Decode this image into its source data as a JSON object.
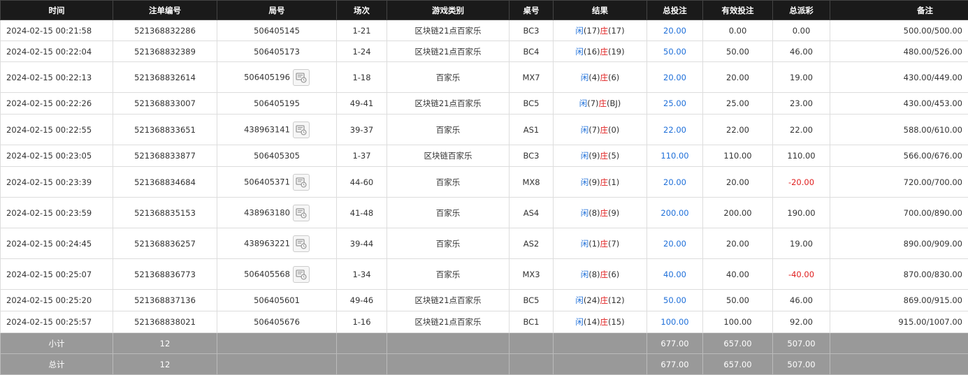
{
  "headers": [
    "时间",
    "注单编号",
    "局号",
    "场次",
    "游戏类别",
    "桌号",
    "结果",
    "总投注",
    "有效投注",
    "总派彩",
    "备注"
  ],
  "rows": [
    {
      "time": "2024-02-15 00:21:58",
      "order": "521368832286",
      "round": "506405145",
      "icon": false,
      "session": "1-21",
      "game": "区块链21点百家乐",
      "table": "BC3",
      "xian": "闲",
      "xv": "(17)",
      "zhuang": "庄",
      "zv": "(17)",
      "bet": "20.00",
      "valid": "0.00",
      "payout": "0.00",
      "neg": false,
      "remark": "500.00/500.00",
      "h": 30
    },
    {
      "time": "2024-02-15 00:22:04",
      "order": "521368832389",
      "round": "506405173",
      "icon": false,
      "session": "1-24",
      "game": "区块链21点百家乐",
      "table": "BC4",
      "xian": "闲",
      "xv": "(16)",
      "zhuang": "庄",
      "zv": "(19)",
      "bet": "50.00",
      "valid": "50.00",
      "payout": "46.00",
      "neg": false,
      "remark": "480.00/526.00",
      "h": 30
    },
    {
      "time": "2024-02-15 00:22:13",
      "order": "521368832614",
      "round": "506405196",
      "icon": true,
      "session": "1-18",
      "game": "百家乐",
      "table": "MX7",
      "xian": "闲",
      "xv": "(4)",
      "zhuang": "庄",
      "zv": "(6)",
      "bet": "20.00",
      "valid": "20.00",
      "payout": "19.00",
      "neg": false,
      "remark": "430.00/449.00",
      "h": 44
    },
    {
      "time": "2024-02-15 00:22:26",
      "order": "521368833007",
      "round": "506405195",
      "icon": false,
      "session": "49-41",
      "game": "区块链21点百家乐",
      "table": "BC5",
      "xian": "闲",
      "xv": "(7)",
      "zhuang": "庄",
      "zv": "(BJ)",
      "bet": "25.00",
      "valid": "25.00",
      "payout": "23.00",
      "neg": false,
      "remark": "430.00/453.00",
      "h": 31
    },
    {
      "time": "2024-02-15 00:22:55",
      "order": "521368833651",
      "round": "438963141",
      "icon": true,
      "session": "39-37",
      "game": "百家乐",
      "table": "AS1",
      "xian": "闲",
      "xv": "(7)",
      "zhuang": "庄",
      "zv": "(0)",
      "bet": "22.00",
      "valid": "22.00",
      "payout": "22.00",
      "neg": false,
      "remark": "588.00/610.00",
      "h": 44
    },
    {
      "time": "2024-02-15 00:23:05",
      "order": "521368833877",
      "round": "506405305",
      "icon": false,
      "session": "1-37",
      "game": "区块链百家乐",
      "table": "BC3",
      "xian": "闲",
      "xv": "(9)",
      "zhuang": "庄",
      "zv": "(5)",
      "bet": "110.00",
      "valid": "110.00",
      "payout": "110.00",
      "neg": false,
      "remark": "566.00/676.00",
      "h": 31
    },
    {
      "time": "2024-02-15 00:23:39",
      "order": "521368834684",
      "round": "506405371",
      "icon": true,
      "session": "44-60",
      "game": "百家乐",
      "table": "MX8",
      "xian": "闲",
      "xv": "(9)",
      "zhuang": "庄",
      "zv": "(1)",
      "bet": "20.00",
      "valid": "20.00",
      "payout": "-20.00",
      "neg": true,
      "remark": "720.00/700.00",
      "h": 44
    },
    {
      "time": "2024-02-15 00:23:59",
      "order": "521368835153",
      "round": "438963180",
      "icon": true,
      "session": "41-48",
      "game": "百家乐",
      "table": "AS4",
      "xian": "闲",
      "xv": "(8)",
      "zhuang": "庄",
      "zv": "(9)",
      "bet": "200.00",
      "valid": "200.00",
      "payout": "190.00",
      "neg": false,
      "remark": "700.00/890.00",
      "h": 44
    },
    {
      "time": "2024-02-15 00:24:45",
      "order": "521368836257",
      "round": "438963221",
      "icon": true,
      "session": "39-44",
      "game": "百家乐",
      "table": "AS2",
      "xian": "闲",
      "xv": "(1)",
      "zhuang": "庄",
      "zv": "(7)",
      "bet": "20.00",
      "valid": "20.00",
      "payout": "19.00",
      "neg": false,
      "remark": "890.00/909.00",
      "h": 44
    },
    {
      "time": "2024-02-15 00:25:07",
      "order": "521368836773",
      "round": "506405568",
      "icon": true,
      "session": "1-34",
      "game": "百家乐",
      "table": "MX3",
      "xian": "闲",
      "xv": "(8)",
      "zhuang": "庄",
      "zv": "(6)",
      "bet": "40.00",
      "valid": "40.00",
      "payout": "-40.00",
      "neg": true,
      "remark": "870.00/830.00",
      "h": 44
    },
    {
      "time": "2024-02-15 00:25:20",
      "order": "521368837136",
      "round": "506405601",
      "icon": false,
      "session": "49-46",
      "game": "区块链21点百家乐",
      "table": "BC5",
      "xian": "闲",
      "xv": "(24)",
      "zhuang": "庄",
      "zv": "(12)",
      "bet": "50.00",
      "valid": "50.00",
      "payout": "46.00",
      "neg": false,
      "remark": "869.00/915.00",
      "h": 31
    },
    {
      "time": "2024-02-15 00:25:57",
      "order": "521368838021",
      "round": "506405676",
      "icon": false,
      "session": "1-16",
      "game": "区块链21点百家乐",
      "table": "BC1",
      "xian": "闲",
      "xv": "(14)",
      "zhuang": "庄",
      "zv": "(15)",
      "bet": "100.00",
      "valid": "100.00",
      "payout": "92.00",
      "neg": false,
      "remark": "915.00/1007.00",
      "h": 31
    }
  ],
  "subtotal": {
    "label": "小计",
    "count": "12",
    "bet": "677.00",
    "valid": "657.00",
    "payout": "507.00"
  },
  "total": {
    "label": "总计",
    "count": "12",
    "bet": "677.00",
    "valid": "657.00",
    "payout": "507.00"
  },
  "colors": {
    "header_bg": "#1a1a1a",
    "summary_bg": "#999999",
    "blue": "#1e6fd9",
    "red": "#e02020"
  },
  "icons": {
    "round_icon": "replay-icon"
  }
}
